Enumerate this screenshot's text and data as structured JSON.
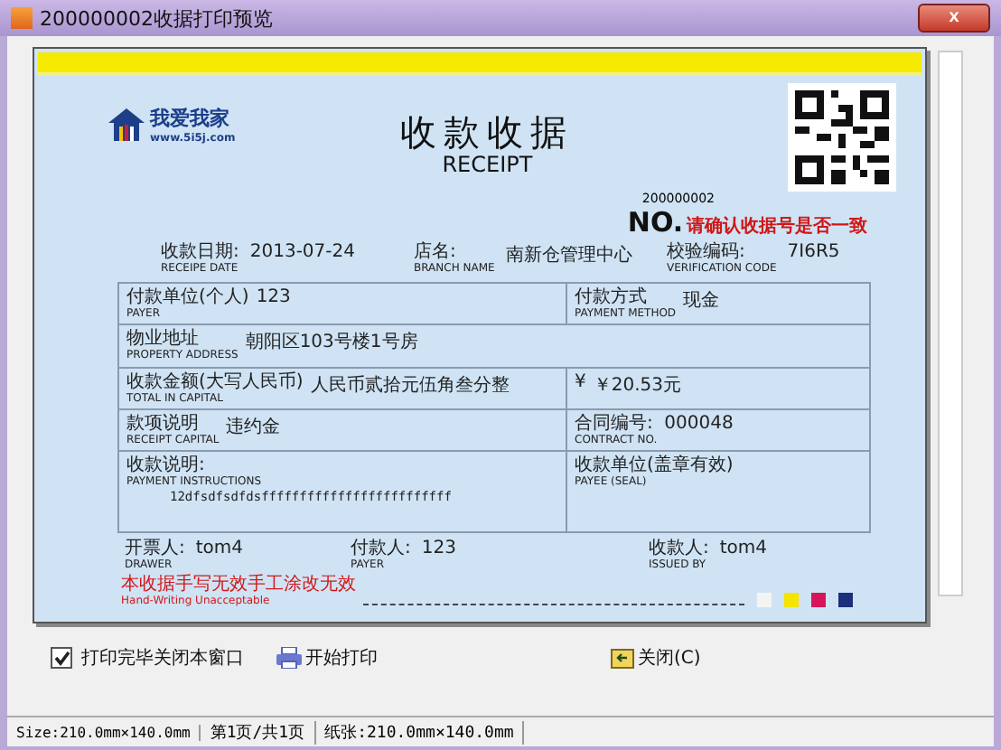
{
  "window": {
    "title": "200000002收据打印预览",
    "close": "x"
  },
  "receipt": {
    "logo_text": "我爱我家",
    "logo_url": "www.5i5j.com",
    "title": "收款收据",
    "subtitle": "RECEIPT",
    "receipt_no": "200000002",
    "no_label": "NO.",
    "no_notice": "请确认收据号是否一致",
    "header_fields": [
      {
        "label": "收款日期:",
        "label_en": "RECEIPE DATE",
        "value": "2013-07-24"
      },
      {
        "label": "店名:",
        "label_en": "BRANCH NAME",
        "value": "南新仓管理中心"
      },
      {
        "label": "校验编码:",
        "label_en": "VERIFICATION CODE",
        "value": "7I6R5"
      }
    ],
    "rows": [
      {
        "kind": "split",
        "left": {
          "label": "付款单位(个人)",
          "label_en": "PAYER",
          "value": "123"
        },
        "right": {
          "label": "付款方式",
          "label_en": "PAYMENT METHOD",
          "value": "现金"
        }
      },
      {
        "kind": "full",
        "left": {
          "label": "物业地址",
          "label_en": "PROPERTY ADDRESS",
          "value": "朝阳区103号楼1号房"
        }
      },
      {
        "kind": "split",
        "left": {
          "label": "收款金额(大写人民币)",
          "label_en": "TOTAL IN CAPITAL",
          "value": "人民币贰拾元伍角叁分整"
        },
        "right": {
          "label": "¥",
          "value": "￥20.53元"
        }
      },
      {
        "kind": "split",
        "left": {
          "label": "款项说明",
          "label_en": "RECEIPT CAPITAL",
          "value": "违约金"
        },
        "right": {
          "label": "合同编号:",
          "label_en": "CONTRACT NO.",
          "value": "000048"
        }
      },
      {
        "kind": "tall",
        "left": {
          "label": "收款说明:",
          "label_en": "PAYMENT INSTRUCTIONS",
          "value": "12dfsdfsdfdsfffffffffffffffffffffffff"
        },
        "right": {
          "label": "收款单位(盖章有效)",
          "label_en": "PAYEE (SEAL)"
        }
      }
    ],
    "signatures": [
      {
        "label": "开票人:",
        "label_en": "DRAWER",
        "value": "tom4"
      },
      {
        "label": "付款人:",
        "label_en": "PAYER",
        "value": "123"
      },
      {
        "label": "收款人:",
        "label_en": "ISSUED BY",
        "value": "tom4"
      }
    ],
    "footer_warning": "本收据手写无效手工涂改无效",
    "footer_warning_en": "Hand-Writing Unacceptable",
    "swatches": [
      {
        "color": "#f4f4f4"
      },
      {
        "color": "#f5e400"
      },
      {
        "color": "#d8145a"
      },
      {
        "color": "#1c2f7a"
      }
    ]
  },
  "controls": {
    "close_after_print": {
      "label": "打印完毕关闭本窗口",
      "checked": true
    },
    "print_button": "开始打印",
    "close_button": "关闭(C)"
  },
  "status_bar": [
    "Size:210.0mm×140.0mm",
    "第1页/共1页",
    "纸张:210.0mm×140.0mm"
  ]
}
